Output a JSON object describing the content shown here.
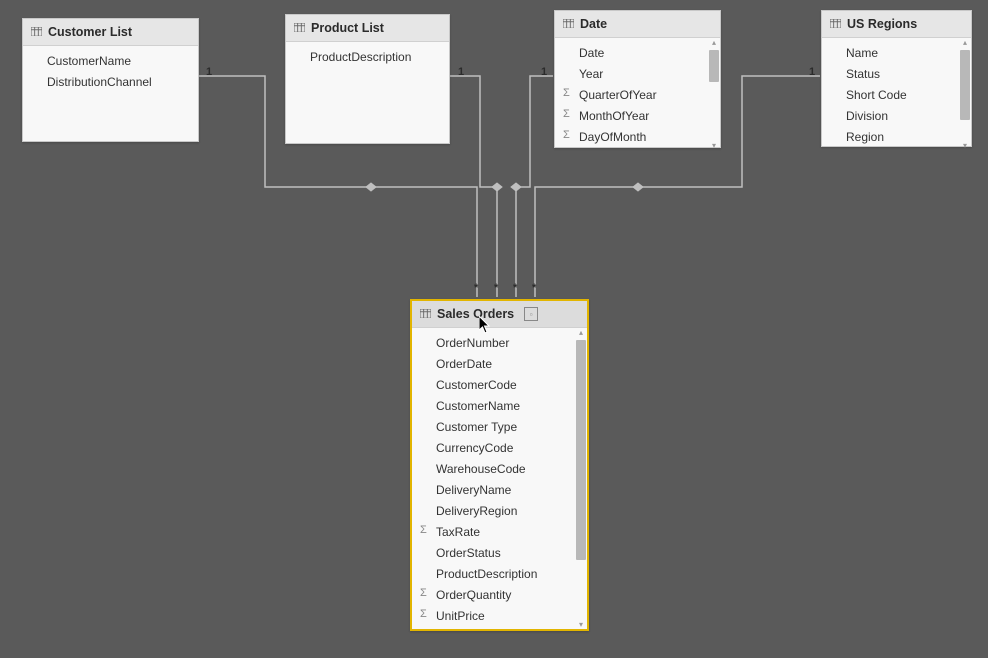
{
  "tables": {
    "customer": {
      "title": "Customer List",
      "fields": [
        {
          "name": "CustomerName",
          "sigma": false
        },
        {
          "name": "DistributionChannel",
          "sigma": false
        }
      ]
    },
    "product": {
      "title": "Product List",
      "fields": [
        {
          "name": "ProductDescription",
          "sigma": false
        }
      ]
    },
    "date": {
      "title": "Date",
      "fields": [
        {
          "name": "Date",
          "sigma": false
        },
        {
          "name": "Year",
          "sigma": false
        },
        {
          "name": "QuarterOfYear",
          "sigma": true
        },
        {
          "name": "MonthOfYear",
          "sigma": true
        },
        {
          "name": "DayOfMonth",
          "sigma": true
        }
      ]
    },
    "regions": {
      "title": "US Regions",
      "fields": [
        {
          "name": "Name",
          "sigma": false
        },
        {
          "name": "Status",
          "sigma": false
        },
        {
          "name": "Short Code",
          "sigma": false
        },
        {
          "name": "Division",
          "sigma": false
        },
        {
          "name": "Region",
          "sigma": false
        }
      ]
    },
    "sales": {
      "title": "Sales Orders",
      "fields": [
        {
          "name": "OrderNumber",
          "sigma": false
        },
        {
          "name": "OrderDate",
          "sigma": false
        },
        {
          "name": "CustomerCode",
          "sigma": false
        },
        {
          "name": "CustomerName",
          "sigma": false
        },
        {
          "name": "Customer Type",
          "sigma": false
        },
        {
          "name": "CurrencyCode",
          "sigma": false
        },
        {
          "name": "WarehouseCode",
          "sigma": false
        },
        {
          "name": "DeliveryName",
          "sigma": false
        },
        {
          "name": "DeliveryRegion",
          "sigma": false
        },
        {
          "name": "TaxRate",
          "sigma": true
        },
        {
          "name": "OrderStatus",
          "sigma": false
        },
        {
          "name": "ProductDescription",
          "sigma": false
        },
        {
          "name": "OrderQuantity",
          "sigma": true
        },
        {
          "name": "UnitPrice",
          "sigma": true
        }
      ]
    }
  },
  "relations": {
    "customer_sales": "1",
    "product_sales": "1",
    "date_sales": "1",
    "regions_sales": "1",
    "many_end": "*"
  },
  "chart_data": {
    "type": "table",
    "description": "Entity-relationship / star schema diagram",
    "fact_table": "Sales Orders",
    "dimension_tables": [
      "Customer List",
      "Product List",
      "Date",
      "US Regions"
    ],
    "relationships": [
      {
        "from": "Customer List",
        "to": "Sales Orders",
        "cardinality": "1:*"
      },
      {
        "from": "Product List",
        "to": "Sales Orders",
        "cardinality": "1:*"
      },
      {
        "from": "Date",
        "to": "Sales Orders",
        "cardinality": "1:*"
      },
      {
        "from": "US Regions",
        "to": "Sales Orders",
        "cardinality": "1:*"
      }
    ]
  }
}
